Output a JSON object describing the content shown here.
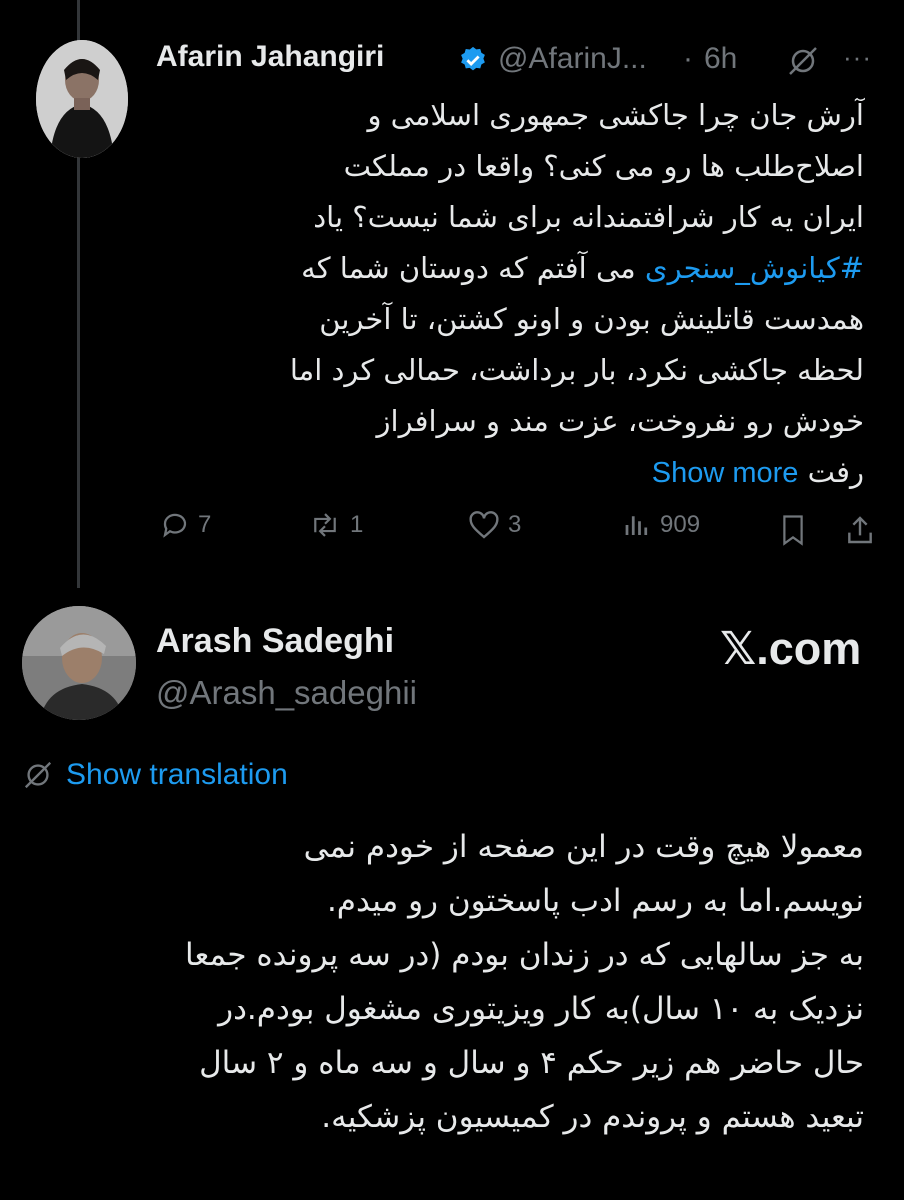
{
  "tweet1": {
    "author_name": "Afarin Jahangiri",
    "handle": "@AfarinJ...",
    "dot": "·",
    "time": "6h",
    "more": "···",
    "lines": [
      "آرش جان چرا جاکشی جمهوری اسلامی و",
      "اصلاح‌طلب ها رو می کنی؟ واقعا در مملکت",
      "ایران یه کار شرافتمندانه برای شما نیست؟ یاد",
      "می آفتم که دوستان شما که",
      "همدست قاتلینش بودن و اونو کشتن، تا آخرین",
      "لحظه جاکشی نکرد، بار برداشت، حمالی کرد اما",
      "خودش رو نفروخت، عزت مند و سرافراز",
      "رفت"
    ],
    "hashtag": "#کیانوش_سنجری",
    "show_more": "Show more",
    "replies": "7",
    "reposts": "1",
    "likes": "3",
    "views": "909"
  },
  "tweet2": {
    "author_name": "Arash Sadeghi",
    "handle": "@Arash_sadeghii",
    "watermark": "𝕏.com",
    "show_translation": "Show translation",
    "lines": [
      "معمولا هیچ وقت در این صفحه از خودم نمی",
      "نویسم.اما به رسم ادب پاسختون رو میدم.",
      "به جز سالهایی که در زندان بودم (در سه پرونده جمعا",
      "نزدیک به ۱۰ سال)به کار ویزیتوری مشغول بودم.در",
      "حال حاضر هم زیر حکم ۴ و سال و سه ماه و ۲ سال",
      "تبعید هستم و پروندم در کمیسیون پزشکیه."
    ]
  },
  "colors": {
    "background": "#000000",
    "text": "#e7e9ea",
    "muted": "#71767b",
    "link": "#1d9bf0",
    "verified": "#1d9bf0"
  }
}
